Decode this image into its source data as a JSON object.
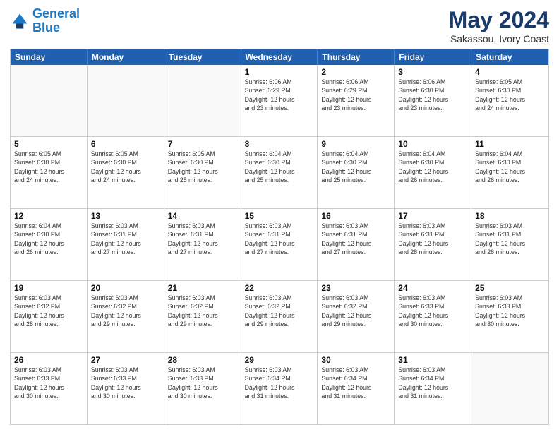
{
  "logo": {
    "line1": "General",
    "line2": "Blue"
  },
  "title": "May 2024",
  "subtitle": "Sakassou, Ivory Coast",
  "header_days": [
    "Sunday",
    "Monday",
    "Tuesday",
    "Wednesday",
    "Thursday",
    "Friday",
    "Saturday"
  ],
  "weeks": [
    [
      {
        "day": "",
        "info": "",
        "empty": true
      },
      {
        "day": "",
        "info": "",
        "empty": true
      },
      {
        "day": "",
        "info": "",
        "empty": true
      },
      {
        "day": "1",
        "info": "Sunrise: 6:06 AM\nSunset: 6:29 PM\nDaylight: 12 hours\nand 23 minutes."
      },
      {
        "day": "2",
        "info": "Sunrise: 6:06 AM\nSunset: 6:29 PM\nDaylight: 12 hours\nand 23 minutes."
      },
      {
        "day": "3",
        "info": "Sunrise: 6:06 AM\nSunset: 6:30 PM\nDaylight: 12 hours\nand 23 minutes."
      },
      {
        "day": "4",
        "info": "Sunrise: 6:05 AM\nSunset: 6:30 PM\nDaylight: 12 hours\nand 24 minutes."
      }
    ],
    [
      {
        "day": "5",
        "info": "Sunrise: 6:05 AM\nSunset: 6:30 PM\nDaylight: 12 hours\nand 24 minutes."
      },
      {
        "day": "6",
        "info": "Sunrise: 6:05 AM\nSunset: 6:30 PM\nDaylight: 12 hours\nand 24 minutes."
      },
      {
        "day": "7",
        "info": "Sunrise: 6:05 AM\nSunset: 6:30 PM\nDaylight: 12 hours\nand 25 minutes."
      },
      {
        "day": "8",
        "info": "Sunrise: 6:04 AM\nSunset: 6:30 PM\nDaylight: 12 hours\nand 25 minutes."
      },
      {
        "day": "9",
        "info": "Sunrise: 6:04 AM\nSunset: 6:30 PM\nDaylight: 12 hours\nand 25 minutes."
      },
      {
        "day": "10",
        "info": "Sunrise: 6:04 AM\nSunset: 6:30 PM\nDaylight: 12 hours\nand 26 minutes."
      },
      {
        "day": "11",
        "info": "Sunrise: 6:04 AM\nSunset: 6:30 PM\nDaylight: 12 hours\nand 26 minutes."
      }
    ],
    [
      {
        "day": "12",
        "info": "Sunrise: 6:04 AM\nSunset: 6:30 PM\nDaylight: 12 hours\nand 26 minutes."
      },
      {
        "day": "13",
        "info": "Sunrise: 6:03 AM\nSunset: 6:31 PM\nDaylight: 12 hours\nand 27 minutes."
      },
      {
        "day": "14",
        "info": "Sunrise: 6:03 AM\nSunset: 6:31 PM\nDaylight: 12 hours\nand 27 minutes."
      },
      {
        "day": "15",
        "info": "Sunrise: 6:03 AM\nSunset: 6:31 PM\nDaylight: 12 hours\nand 27 minutes."
      },
      {
        "day": "16",
        "info": "Sunrise: 6:03 AM\nSunset: 6:31 PM\nDaylight: 12 hours\nand 27 minutes."
      },
      {
        "day": "17",
        "info": "Sunrise: 6:03 AM\nSunset: 6:31 PM\nDaylight: 12 hours\nand 28 minutes."
      },
      {
        "day": "18",
        "info": "Sunrise: 6:03 AM\nSunset: 6:31 PM\nDaylight: 12 hours\nand 28 minutes."
      }
    ],
    [
      {
        "day": "19",
        "info": "Sunrise: 6:03 AM\nSunset: 6:32 PM\nDaylight: 12 hours\nand 28 minutes."
      },
      {
        "day": "20",
        "info": "Sunrise: 6:03 AM\nSunset: 6:32 PM\nDaylight: 12 hours\nand 29 minutes."
      },
      {
        "day": "21",
        "info": "Sunrise: 6:03 AM\nSunset: 6:32 PM\nDaylight: 12 hours\nand 29 minutes."
      },
      {
        "day": "22",
        "info": "Sunrise: 6:03 AM\nSunset: 6:32 PM\nDaylight: 12 hours\nand 29 minutes."
      },
      {
        "day": "23",
        "info": "Sunrise: 6:03 AM\nSunset: 6:32 PM\nDaylight: 12 hours\nand 29 minutes."
      },
      {
        "day": "24",
        "info": "Sunrise: 6:03 AM\nSunset: 6:33 PM\nDaylight: 12 hours\nand 30 minutes."
      },
      {
        "day": "25",
        "info": "Sunrise: 6:03 AM\nSunset: 6:33 PM\nDaylight: 12 hours\nand 30 minutes."
      }
    ],
    [
      {
        "day": "26",
        "info": "Sunrise: 6:03 AM\nSunset: 6:33 PM\nDaylight: 12 hours\nand 30 minutes."
      },
      {
        "day": "27",
        "info": "Sunrise: 6:03 AM\nSunset: 6:33 PM\nDaylight: 12 hours\nand 30 minutes."
      },
      {
        "day": "28",
        "info": "Sunrise: 6:03 AM\nSunset: 6:33 PM\nDaylight: 12 hours\nand 30 minutes."
      },
      {
        "day": "29",
        "info": "Sunrise: 6:03 AM\nSunset: 6:34 PM\nDaylight: 12 hours\nand 31 minutes."
      },
      {
        "day": "30",
        "info": "Sunrise: 6:03 AM\nSunset: 6:34 PM\nDaylight: 12 hours\nand 31 minutes."
      },
      {
        "day": "31",
        "info": "Sunrise: 6:03 AM\nSunset: 6:34 PM\nDaylight: 12 hours\nand 31 minutes."
      },
      {
        "day": "",
        "info": "",
        "empty": true
      }
    ]
  ]
}
